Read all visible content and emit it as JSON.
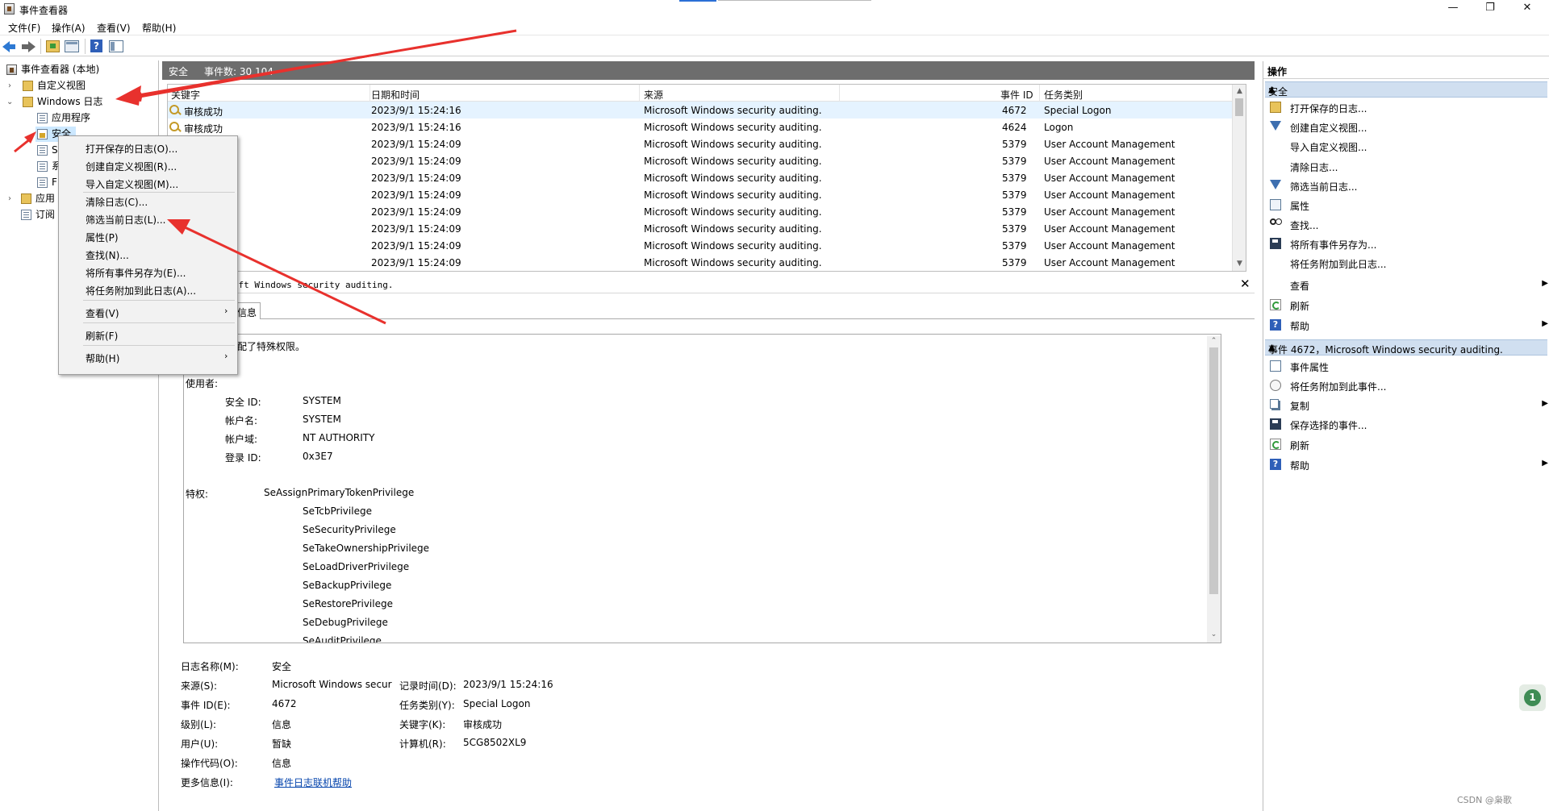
{
  "window": {
    "title": "事件查看器",
    "controls": {
      "minimize": "—",
      "maximize": "❐",
      "close": "✕"
    }
  },
  "menubar": [
    "文件(F)",
    "操作(A)",
    "查看(V)",
    "帮助(H)"
  ],
  "toolbar": {
    "icons": [
      "back-arrow-icon",
      "forward-arrow-icon",
      "open-folder-icon",
      "properties-icon",
      "help-icon",
      "show-pane-icon"
    ]
  },
  "tree": {
    "root": "事件查看器 (本地)",
    "custom_views": "自定义视图",
    "windows_logs": "Windows 日志",
    "application": "应用程序",
    "security": "安全",
    "s_node": "S",
    "sys_node": "系",
    "f_node": "F",
    "apps_services": "应用",
    "subscriptions": "订阅"
  },
  "events_header": {
    "log_name": "安全",
    "count_label": "事件数: 30 104"
  },
  "events_table": {
    "columns": [
      "关键字",
      "日期和时间",
      "来源",
      "事件 ID",
      "任务类别"
    ],
    "rows": [
      [
        "审核成功",
        "2023/9/1 15:24:16",
        "Microsoft Windows security auditing.",
        "4672",
        "Special Logon"
      ],
      [
        "审核成功",
        "2023/9/1 15:24:16",
        "Microsoft Windows security auditing.",
        "4624",
        "Logon"
      ],
      [
        "",
        "2023/9/1 15:24:09",
        "Microsoft Windows security auditing.",
        "5379",
        "User Account Management"
      ],
      [
        "",
        "2023/9/1 15:24:09",
        "Microsoft Windows security auditing.",
        "5379",
        "User Account Management"
      ],
      [
        "",
        "2023/9/1 15:24:09",
        "Microsoft Windows security auditing.",
        "5379",
        "User Account Management"
      ],
      [
        "",
        "2023/9/1 15:24:09",
        "Microsoft Windows security auditing.",
        "5379",
        "User Account Management"
      ],
      [
        "",
        "2023/9/1 15:24:09",
        "Microsoft Windows security auditing.",
        "5379",
        "User Account Management"
      ],
      [
        "",
        "2023/9/1 15:24:09",
        "Microsoft Windows security auditing.",
        "5379",
        "User Account Management"
      ],
      [
        "",
        "2023/9/1 15:24:09",
        "Microsoft Windows security auditing.",
        "5379",
        "User Account Management"
      ],
      [
        "",
        "2023/9/1 15:24:09",
        "Microsoft Windows security auditing.",
        "5379",
        "User Account Management"
      ]
    ]
  },
  "detail": {
    "source_caption": "rosoft Windows security auditing.",
    "close": "✕",
    "tab": "信息",
    "message": {
      "line1": "配了特殊权限。",
      "user_label": "使用者:",
      "sid_label": "安全 ID:",
      "sid": "SYSTEM",
      "account_label": "帐户名:",
      "account": "SYSTEM",
      "domain_label": "帐户域:",
      "domain": "NT AUTHORITY",
      "logon_label": "登录 ID:",
      "logon": "0x3E7",
      "priv_label": "特权:",
      "privileges": [
        "SeAssignPrimaryTokenPrivilege",
        "SeTcbPrivilege",
        "SeSecurityPrivilege",
        "SeTakeOwnershipPrivilege",
        "SeLoadDriverPrivilege",
        "SeBackupPrivilege",
        "SeRestorePrivilege",
        "SeDebugPrivilege",
        "SeAuditPrivilege"
      ]
    },
    "fields": {
      "log_name_label": "日志名称(M):",
      "log_name": "安全",
      "source_label": "来源(S):",
      "source": "Microsoft Windows secur",
      "logged_label": "记录时间(D):",
      "logged": "2023/9/1 15:24:16",
      "event_id_label": "事件 ID(E):",
      "event_id": "4672",
      "task_label": "任务类别(Y):",
      "task": "Special Logon",
      "level_label": "级别(L):",
      "level": "信息",
      "keywords_label": "关键字(K):",
      "keywords": "审核成功",
      "user_label": "用户(U):",
      "user": "暂缺",
      "computer_label": "计算机(R):",
      "computer": "5CG8502XL9",
      "opcode_label": "操作代码(O):",
      "opcode": "信息",
      "more_label": "更多信息(I):",
      "more_link": "事件日志联机帮助"
    }
  },
  "actions": {
    "title": "操作",
    "section1": "安全",
    "items1": [
      "打开保存的日志...",
      "创建自定义视图...",
      "导入自定义视图...",
      "清除日志...",
      "筛选当前日志...",
      "属性",
      "查找...",
      "将所有事件另存为...",
      "将任务附加到此日志...",
      "查看",
      "刷新",
      "帮助"
    ],
    "section2": "事件 4672，Microsoft Windows security auditing.",
    "items2": [
      "事件属性",
      "将任务附加到此事件...",
      "复制",
      "保存选择的事件...",
      "刷新",
      "帮助"
    ]
  },
  "context_menu": {
    "items": [
      "打开保存的日志(O)...",
      "创建自定义视图(R)...",
      "导入自定义视图(M)...",
      "清除日志(C)...",
      "筛选当前日志(L)...",
      "属性(P)",
      "查找(N)...",
      "将所有事件另存为(E)...",
      "将任务附加到此日志(A)...",
      "查看(V)",
      "刷新(F)",
      "帮助(H)"
    ],
    "submenu_arrow": "›"
  },
  "badge": "1",
  "watermark": "CSDN @枭歌",
  "colors": {
    "arrow": "#e8312d",
    "header_bar": "#6d6d6d",
    "section_bg": "#d0dff0",
    "selection": "#cce8ff"
  }
}
